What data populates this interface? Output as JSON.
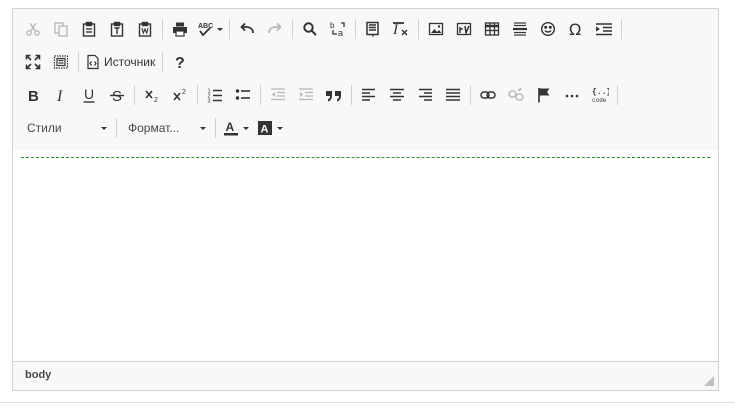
{
  "toolbar": {
    "source_label": "Источник",
    "styles_label": "Стили",
    "format_label": "Формат..."
  },
  "statusbar": {
    "path": "body"
  },
  "colors": {
    "icon": "#333333",
    "icon_disabled": "#b8b8b8",
    "border": "#d1d1d1",
    "toolbar_bg": "#f8f8f8",
    "dashed_line": "#2e8b2e"
  }
}
